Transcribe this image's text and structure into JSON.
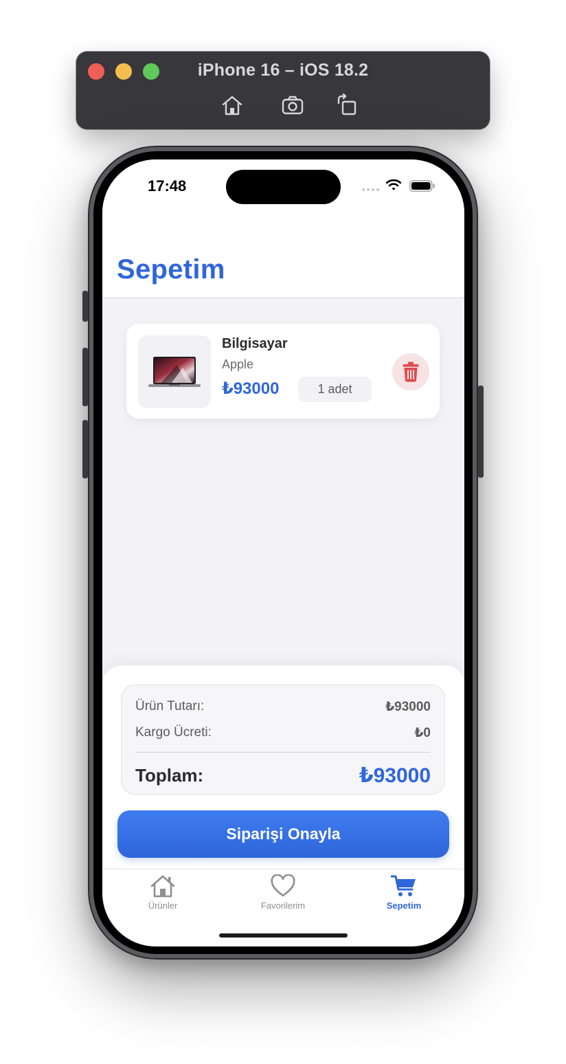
{
  "simulator": {
    "title": "iPhone 16 – iOS 18.2",
    "toolbar_icons": [
      "home-icon",
      "screenshot-icon",
      "rotate-icon"
    ]
  },
  "status_bar": {
    "time": "17:48"
  },
  "header": {
    "title": "Sepetim"
  },
  "cart": {
    "items": [
      {
        "name": "Bilgisayar",
        "brand": "Apple",
        "price": "₺93000",
        "quantity": "1 adet",
        "image_icon": "laptop-image"
      }
    ]
  },
  "summary": {
    "subtotal_label": "Ürün Tutarı:",
    "subtotal_value": "₺93000",
    "shipping_label": "Kargo Ücreti:",
    "shipping_value": "₺0",
    "total_label": "Toplam:",
    "total_value": "₺93000"
  },
  "actions": {
    "confirm_label": "Siparişi Onayla"
  },
  "tabbar": {
    "tabs": [
      {
        "label": "Ürünler",
        "icon": "house-icon",
        "active": false
      },
      {
        "label": "Favorilerim",
        "icon": "heart-icon",
        "active": false
      },
      {
        "label": "Sepetim",
        "icon": "cart-icon",
        "active": true
      }
    ]
  },
  "colors": {
    "accent": "#2f66d9",
    "delete_bg": "#f7e3e4",
    "delete_icon": "#e0494f",
    "background": "#f3f3f7"
  }
}
